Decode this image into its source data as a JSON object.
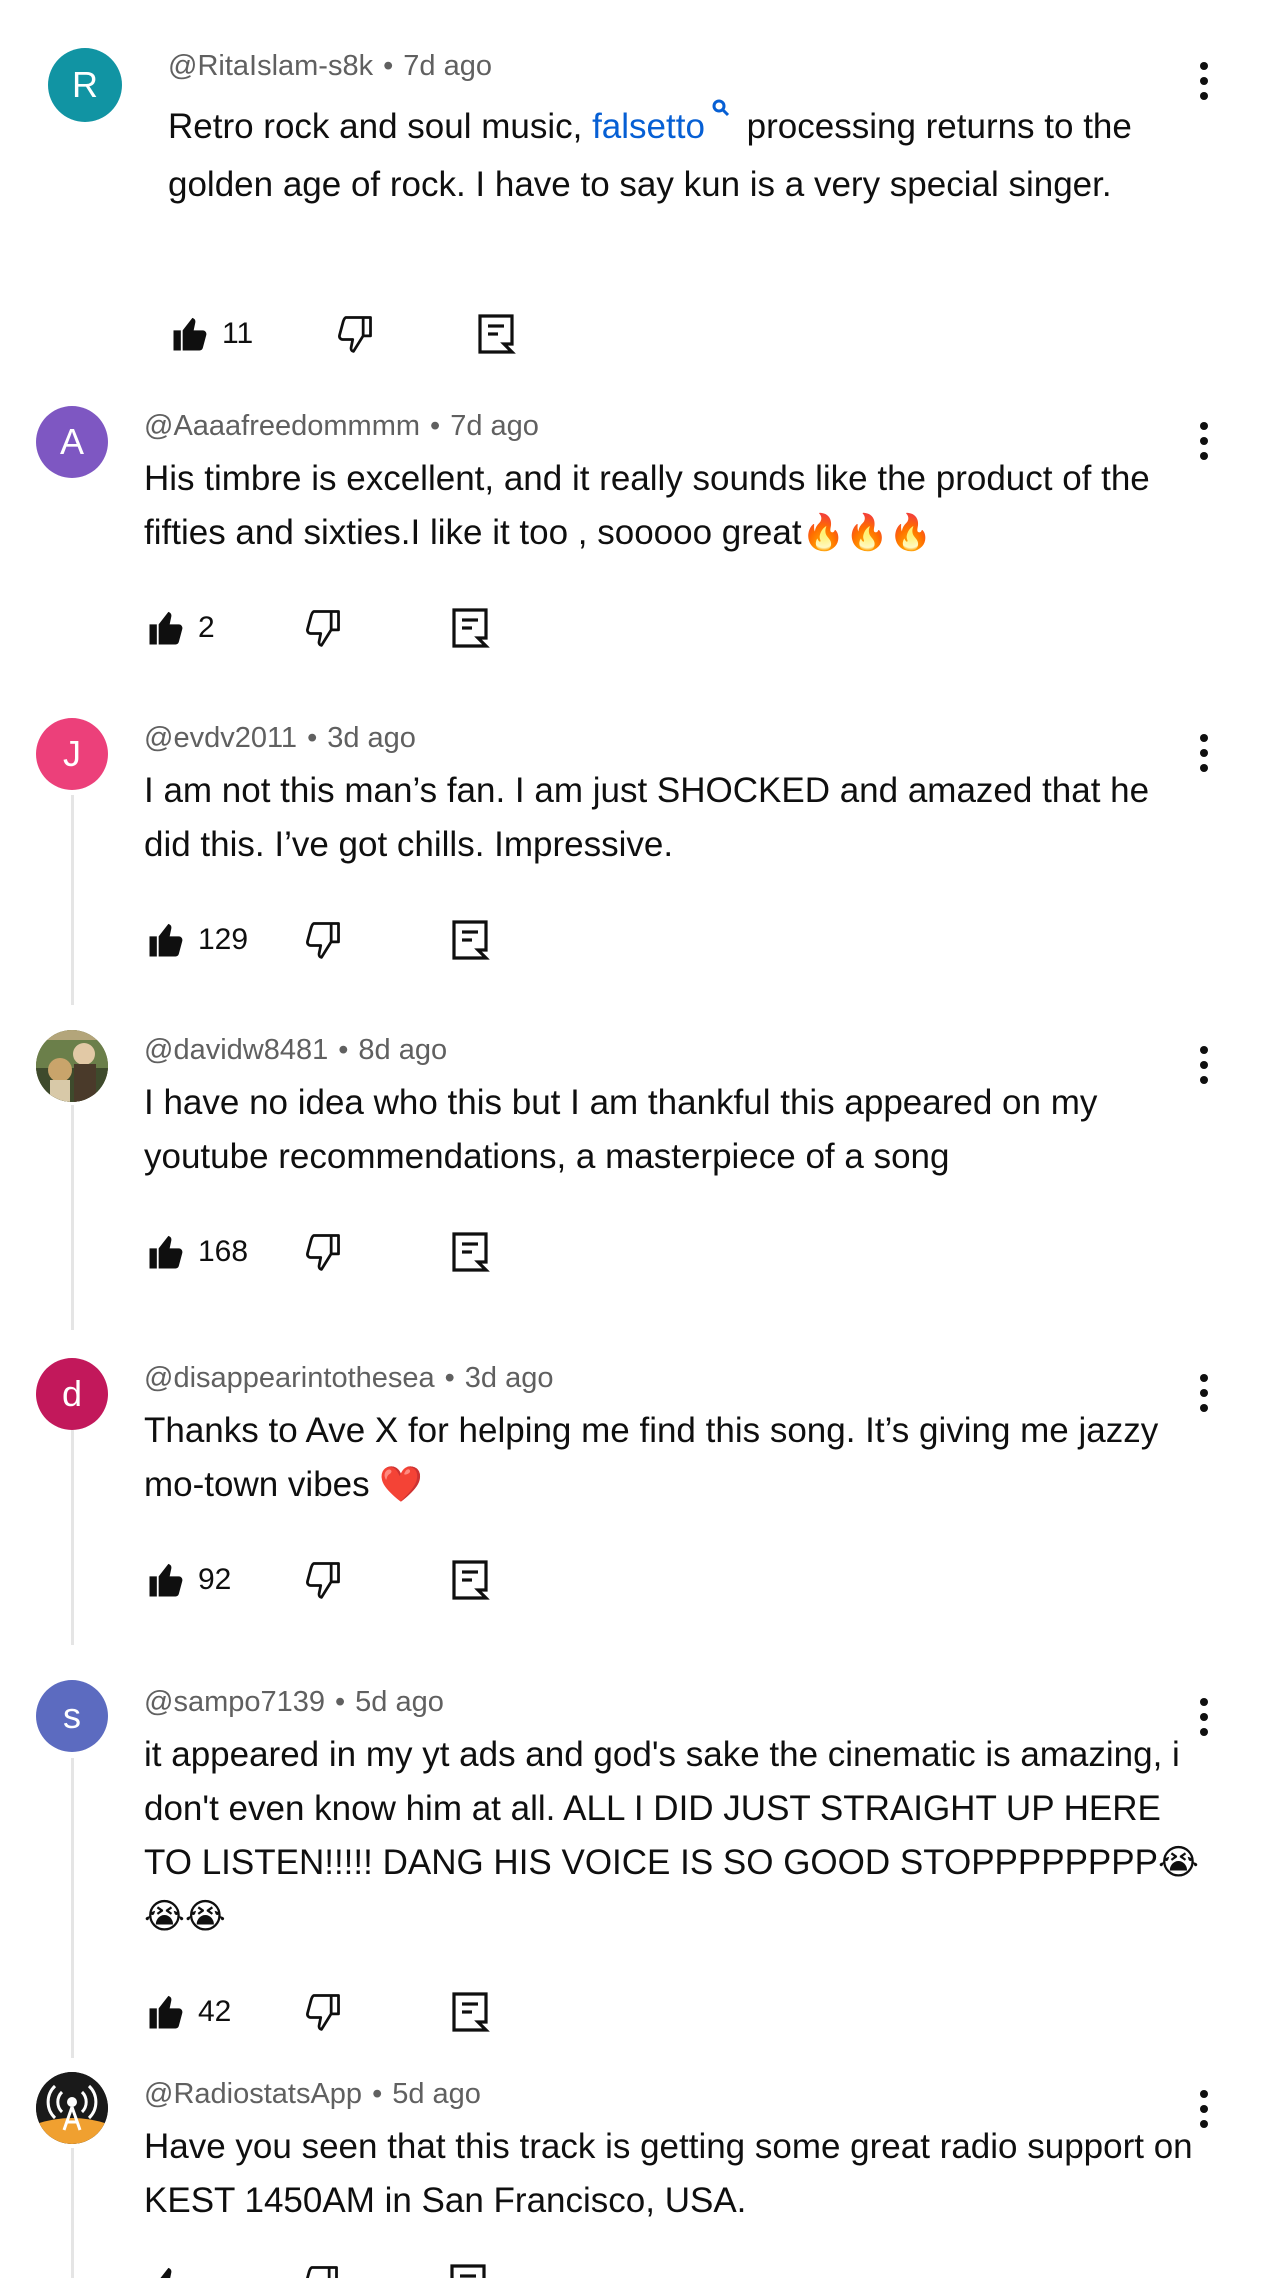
{
  "comments": [
    {
      "handle": "@RitaIslam-s8k",
      "time": "7d ago",
      "avatar_letter": "R",
      "avatar_color": "#1194a3",
      "text_before": "Retro rock and soul music, ",
      "link": "falsetto",
      "text_after": " processing returns to the golden age of rock. I have to say kun is a very special singer.",
      "likes": "11"
    },
    {
      "handle": "@Aaaafreedommmm",
      "time": "7d ago",
      "avatar_letter": "A",
      "avatar_color": "#7e57c2",
      "text": "His timbre is excellent, and it really sounds like the product of the fifties and sixties.I like it  too ,  sooooo great",
      "emoji": "🔥🔥🔥",
      "likes": "2"
    },
    {
      "handle": "@evdv2011",
      "time": "3d ago",
      "avatar_letter": "J",
      "avatar_color": "#ec407a",
      "text": "I am not this man’s fan. I am just SHOCKED and amazed that he did this. I’ve got chills. Impressive.",
      "likes": "129"
    },
    {
      "handle": "@davidw8481",
      "time": "8d ago",
      "avatar_letter": "",
      "avatar_color": "#6d5a3b",
      "text": "I have no idea who this but I am thankful this appeared on my youtube recommendations, a masterpiece of a song",
      "likes": "168"
    },
    {
      "handle": "@disappearintothesea",
      "time": "3d ago",
      "avatar_letter": "d",
      "avatar_color": "#c2185b",
      "text": "Thanks to Ave X for helping me find this song. It’s giving me jazzy mo-town vibes",
      "emoji": "❤️",
      "likes": "92"
    },
    {
      "handle": "@sampo7139",
      "time": "5d ago",
      "avatar_letter": "s",
      "avatar_color": "#5c6bc0",
      "text": "it appeared in my yt ads and god's sake the cinematic is amazing, i don't even know him at all. ALL I DID JUST STRAIGHT UP HERE TO LISTEN!!!!! DANG HIS VOICE IS SO GOOD STOPPPPPPPP",
      "emoji": "😭😭😭",
      "likes": "42"
    },
    {
      "handle": "@RadiostatsApp",
      "time": "5d ago",
      "avatar_letter": "",
      "avatar_color": "#1a1a1a",
      "text": "Have you seen that this track is getting some great radio support on KEST 1450AM in San Francisco, USA.",
      "likes": ""
    }
  ],
  "dot": "•"
}
